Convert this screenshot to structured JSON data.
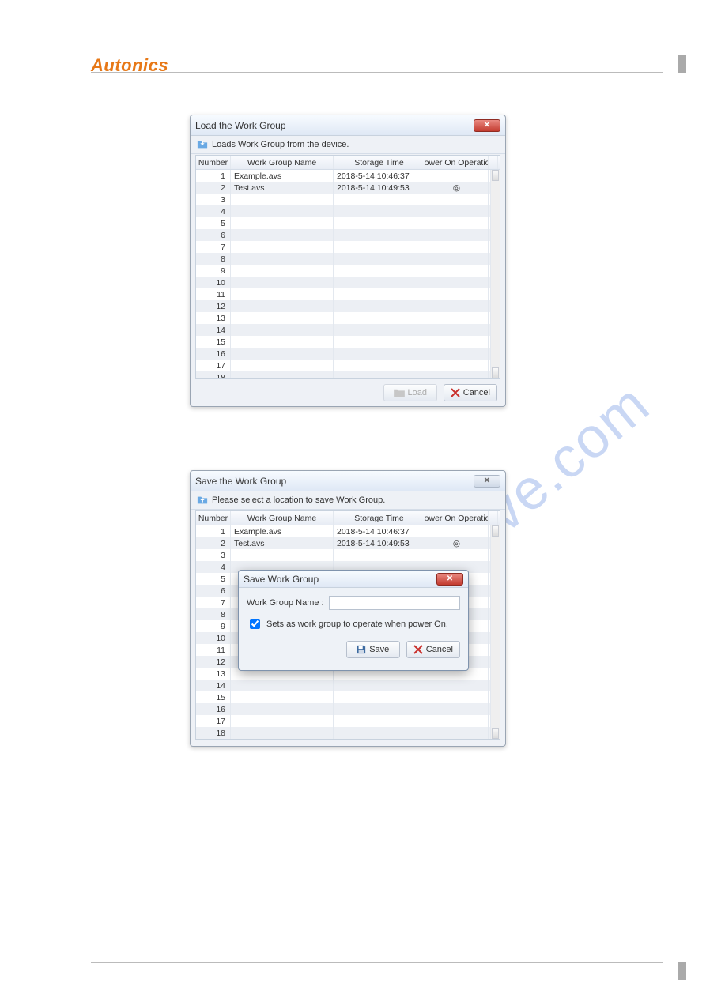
{
  "brand": "Autonics",
  "watermark": "manualshive.com",
  "columns": {
    "number": "Number",
    "name": "Work Group Name",
    "time": "Storage Time",
    "power": "Power On Operation"
  },
  "loadDialog": {
    "title": "Load the Work Group",
    "subtitle": "Loads Work Group from the device.",
    "loadLabel": "Load",
    "cancelLabel": "Cancel",
    "rowCount": 20,
    "rows": [
      {
        "n": 1,
        "name": "Example.avs",
        "time": "2018-5-14 10:46:37",
        "power": ""
      },
      {
        "n": 2,
        "name": "Test.avs",
        "time": "2018-5-14 10:49:53",
        "power": "◎"
      }
    ]
  },
  "saveDialog": {
    "title": "Save the Work Group",
    "subtitle": "Please select a location to save Work Group.",
    "rowCount": 21,
    "rows": [
      {
        "n": 1,
        "name": "Example.avs",
        "time": "2018-5-14 10:46:37",
        "power": ""
      },
      {
        "n": 2,
        "name": "Test.avs",
        "time": "2018-5-14 10:49:53",
        "power": "◎"
      }
    ]
  },
  "innerSave": {
    "title": "Save Work Group",
    "nameLabel": "Work Group Name :",
    "nameValue": "",
    "checkLabel": "Sets as work group to operate when power On.",
    "checked": true,
    "saveLabel": "Save",
    "cancelLabel": "Cancel"
  }
}
